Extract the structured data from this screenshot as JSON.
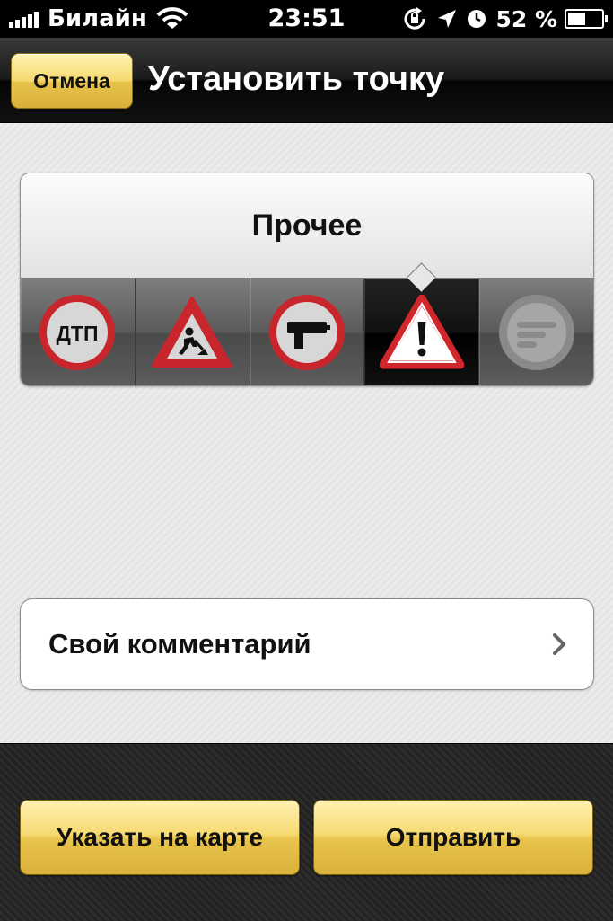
{
  "status_bar": {
    "carrier": "Билайн",
    "time": "23:51",
    "battery_percent": "52 %",
    "battery_level": 0.52
  },
  "navbar": {
    "cancel_label": "Отмена",
    "title": "Установить точку"
  },
  "category_panel": {
    "selected_label": "Прочее",
    "selected_index": 3,
    "items": [
      {
        "icon": "accident-sign-icon",
        "text": "ДТП"
      },
      {
        "icon": "road-works-sign-icon"
      },
      {
        "icon": "speed-camera-sign-icon"
      },
      {
        "icon": "warning-sign-icon"
      },
      {
        "icon": "comment-bubble-icon"
      }
    ]
  },
  "comment_row": {
    "label": "Свой комментарий"
  },
  "bottom_bar": {
    "map_label": "Указать на карте",
    "send_label": "Отправить"
  },
  "colors": {
    "accent_yellow": "#f2d365",
    "sign_red": "#c8262c",
    "navbar_black": "#111111"
  }
}
